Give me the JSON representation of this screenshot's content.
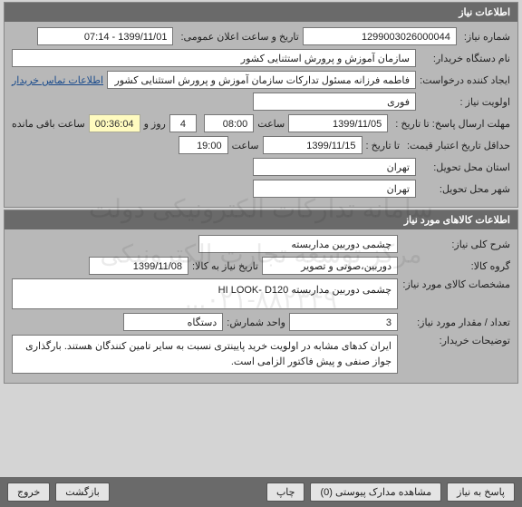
{
  "watermark": {
    "line1": "سامانه تدارکات الکترونیکی دولت",
    "line2": "مركز توسعه تجارت الكترونيكى",
    "line3": "۰۲۱-۸۸۲۳۴۹..."
  },
  "section1": {
    "title": "اطلاعات نیاز",
    "need_number_label": "شماره نیاز:",
    "need_number": "1299003026000044",
    "announce_label": "تاریخ و ساعت اعلان عمومی:",
    "announce_value": "1399/11/01 - 07:14",
    "buyer_label": "نام دستگاه خریدار:",
    "buyer_value": "سازمان آموزش و پرورش استثنایی کشور",
    "creator_label": "ایجاد کننده درخواست:",
    "creator_value": "فاطمه فرزانه مسئول تدارکات سازمان آموزش و پرورش استثنایی کشور",
    "contact_link": "اطلاعات تماس خریدار",
    "priority_label": "اولویت نیاز :",
    "priority_value": "فوری",
    "deadline_label": "مهلت ارسال پاسخ:  تا تاریخ :",
    "deadline_date": "1399/11/05",
    "time_label": "ساعت",
    "deadline_time": "08:00",
    "days_value": "4",
    "days_label": "روز و",
    "countdown": "00:36:04",
    "remaining_label": "ساعت باقی مانده",
    "validity_label": "حداقل تاریخ اعتبار قیمت:",
    "validity_to_label": "تا تاریخ :",
    "validity_date": "1399/11/15",
    "validity_time": "19:00",
    "delivery_province_label": "استان محل تحویل:",
    "delivery_province": "تهران",
    "delivery_city_label": "شهر محل تحویل:",
    "delivery_city": "تهران"
  },
  "section2": {
    "title": "اطلاعات کالاهای مورد نیاز",
    "desc_label": "شرح کلی نیاز:",
    "desc_value": "چشمی دوربین مداربسته",
    "group_label": "گروه کالا:",
    "group_value": "دوربین،صوتی و تصویر",
    "need_to_date_label": "تاریخ نیاز به کالا:",
    "need_to_date": "1399/11/08",
    "spec_label": "مشخصات کالای مورد نیاز:",
    "spec_value": "چشمی دوربین مداربسته HI LOOK- D120",
    "qty_label": "تعداد / مقدار مورد نیاز:",
    "qty_value": "3",
    "unit_label": "واحد شمارش:",
    "unit_value": "دستگاه",
    "notes_label": "توضیحات خریدار:",
    "notes_value": "ایران کدهای مشابه در اولویت خرید پایینتری نسبت به سایر تامین کنندگان هستند. بارگذاری جواز صنفی و پیش فاکتور الزامی است."
  },
  "footer": {
    "respond": "پاسخ به نیاز",
    "attachments": "مشاهده مدارک پیوستی (0)",
    "print": "چاپ",
    "back": "بازگشت",
    "exit": "خروج"
  }
}
